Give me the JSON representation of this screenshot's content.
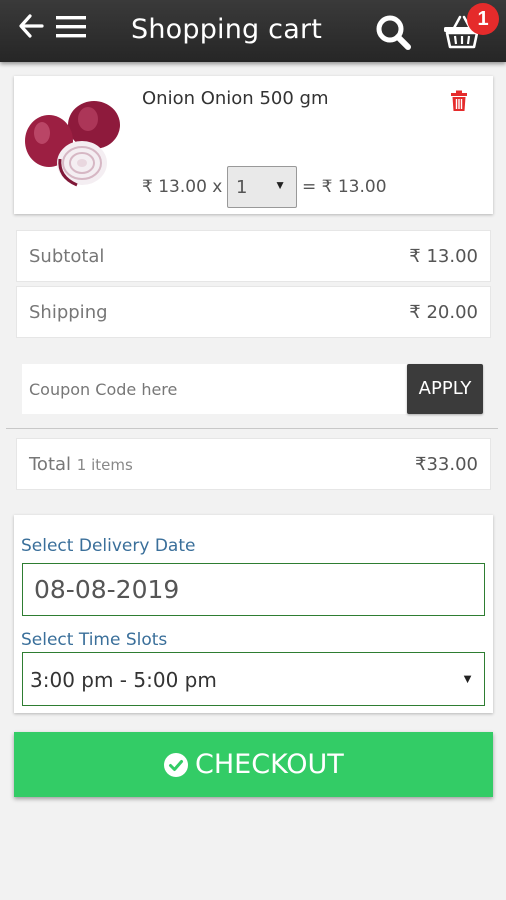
{
  "header": {
    "title": "Shopping cart",
    "cart_count": "1",
    "icons": [
      "back-arrow-icon",
      "hamburger-menu-icon",
      "search-icon",
      "shopping-basket-icon"
    ]
  },
  "cart_item": {
    "name": "Onion Onion 500 gm",
    "unit_price": "₹ 13.00 x",
    "quantity": "1",
    "line_total": "= ₹ 13.00",
    "image": "onion-image",
    "delete_icon": "trash-icon"
  },
  "summary": {
    "subtotal_label": "Subtotal",
    "subtotal_value": "₹ 13.00",
    "shipping_label": "Shipping",
    "shipping_value": "₹ 20.00",
    "total_label": "Total",
    "total_items": "1 items",
    "total_value": "₹33.00"
  },
  "coupon": {
    "placeholder": "Coupon Code here",
    "apply_label": "APPLY"
  },
  "delivery": {
    "date_label": "Select Delivery Date",
    "date_value": "08-08-2019",
    "slot_label": "Select Time Slots",
    "slot_value": "3:00 pm - 5:00 pm"
  },
  "checkout": {
    "label": "CHECKOUT"
  },
  "colors": {
    "header_bg": "#2b2b2b",
    "badge": "#e52b2b",
    "checkout_green": "#33cc66",
    "field_border": "#2e7d32",
    "label_blue": "#3a6f9a",
    "delete_red": "#e52b2b"
  }
}
